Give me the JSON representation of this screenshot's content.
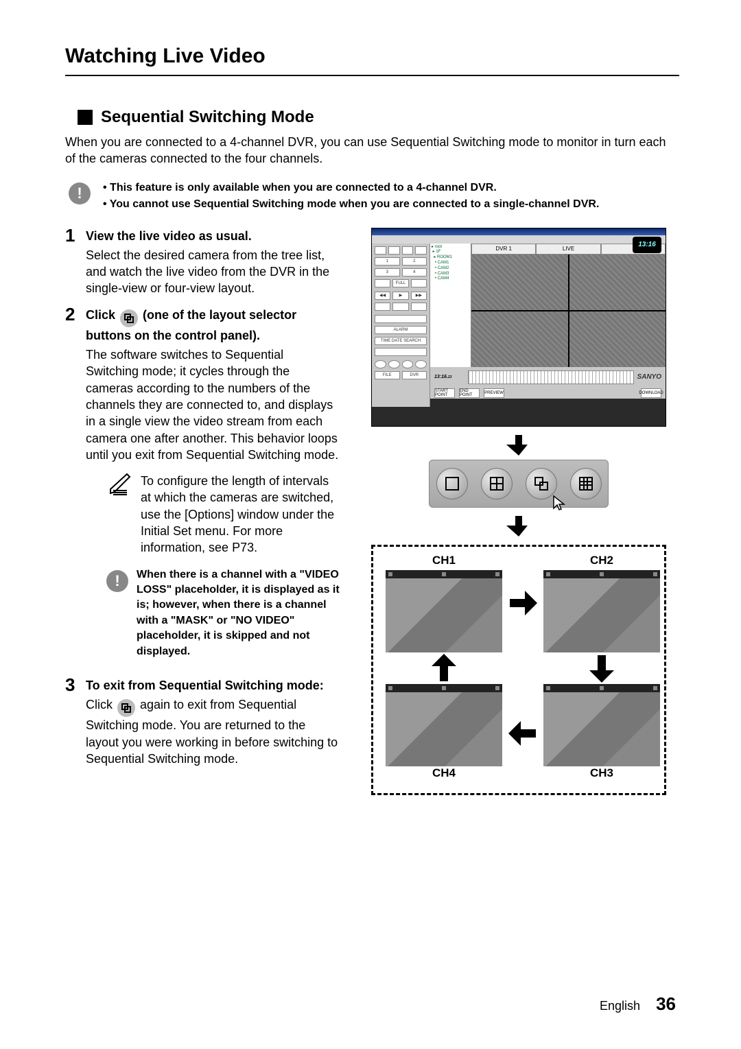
{
  "title": "Watching Live Video",
  "section_heading": "Sequential Switching Mode",
  "intro": "When you are connected to a 4-channel DVR, you can use Sequential Switching mode to monitor in turn each of the cameras connected to the four channels.",
  "caution": {
    "items": [
      "This feature is only available when you are connected to a 4-channel DVR.",
      "You cannot use Sequential Switching mode when you are connected to a single-channel DVR."
    ]
  },
  "steps": {
    "one": {
      "num": "1",
      "head": "View the live video as usual.",
      "body": "Select the desired camera from the tree list, and watch the live video from the DVR in the single-view or four-view layout."
    },
    "two": {
      "num": "2",
      "head_pre": "Click ",
      "head_post": " (one of the layout selector buttons on the control panel).",
      "body": "The software switches to Sequential Switching mode; it cycles through the cameras according to the numbers of the channels they are connected to, and displays in a single view the video stream from each camera one after another. This behavior loops until you exit from Sequential Switching mode.",
      "note": "To configure the length of intervals at which the cameras are switched, use the [Options] window under the Initial Set menu. For more information, see P73.",
      "warn": "When there is a channel with a \"VIDEO LOSS\" placeholder, it is displayed as it is; however, when there is a channel with a \"MASK\" or \"NO VIDEO\" placeholder, it is skipped and not displayed."
    },
    "three": {
      "num": "3",
      "head": "To exit from Sequential Switching mode:",
      "body_pre": "Click ",
      "body_post": " again to exit from Sequential Switching mode. You are returned to the layout you were working in before switching to Sequential Switching mode."
    }
  },
  "illus": {
    "clock": "13:16",
    "dvr_label": "DVR 1",
    "live_label": "LIVE",
    "brand": "SANYO",
    "ch1": "CH1",
    "ch2": "CH2",
    "ch3": "CH3",
    "ch4": "CH4"
  },
  "footer": {
    "lang": "English",
    "page": "36"
  }
}
